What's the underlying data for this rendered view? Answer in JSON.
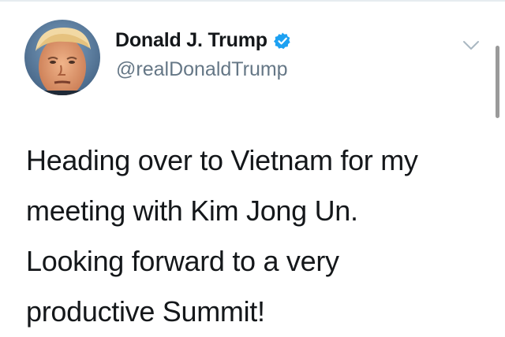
{
  "tweet": {
    "author": {
      "display_name": "Donald J. Trump",
      "handle": "@realDonaldTrump",
      "verified": true,
      "avatar_icon": "profile-photo"
    },
    "text_lines": [
      "Heading over to Vietnam for my",
      "meeting with Kim Jong Un.",
      "Looking forward to a very",
      "productive Summit!"
    ],
    "menu_icon": "chevron-down-icon"
  },
  "colors": {
    "verified_badge": "#1da1f2",
    "name_text": "#14171a",
    "handle_text": "#657786",
    "caret": "#aab8c2",
    "divider": "#e6ecf0"
  }
}
